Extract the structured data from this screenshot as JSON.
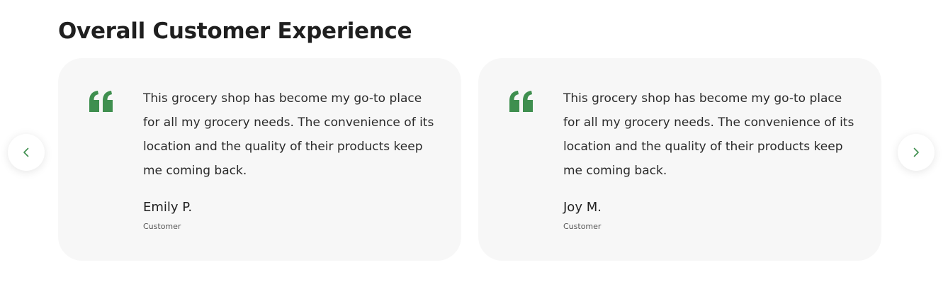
{
  "section": {
    "title": "Overall Customer Experience"
  },
  "colors": {
    "accent": "#3f8f4f",
    "card_background": "#f7f7f7"
  },
  "navigation": {
    "prev_icon": "chevron-left-icon",
    "next_icon": "chevron-right-icon"
  },
  "testimonials": [
    {
      "quote_icon": "quote-icon",
      "text": "This grocery shop has become my go-to place for all my grocery needs. The convenience of its location and the quality of their products keep me coming back.",
      "name": "Emily P.",
      "role": "Customer"
    },
    {
      "quote_icon": "quote-icon",
      "text": "This grocery shop has become my go-to place for all my grocery needs. The convenience of its location and the quality of their products keep me coming back.",
      "name": "Joy M.",
      "role": "Customer"
    }
  ]
}
